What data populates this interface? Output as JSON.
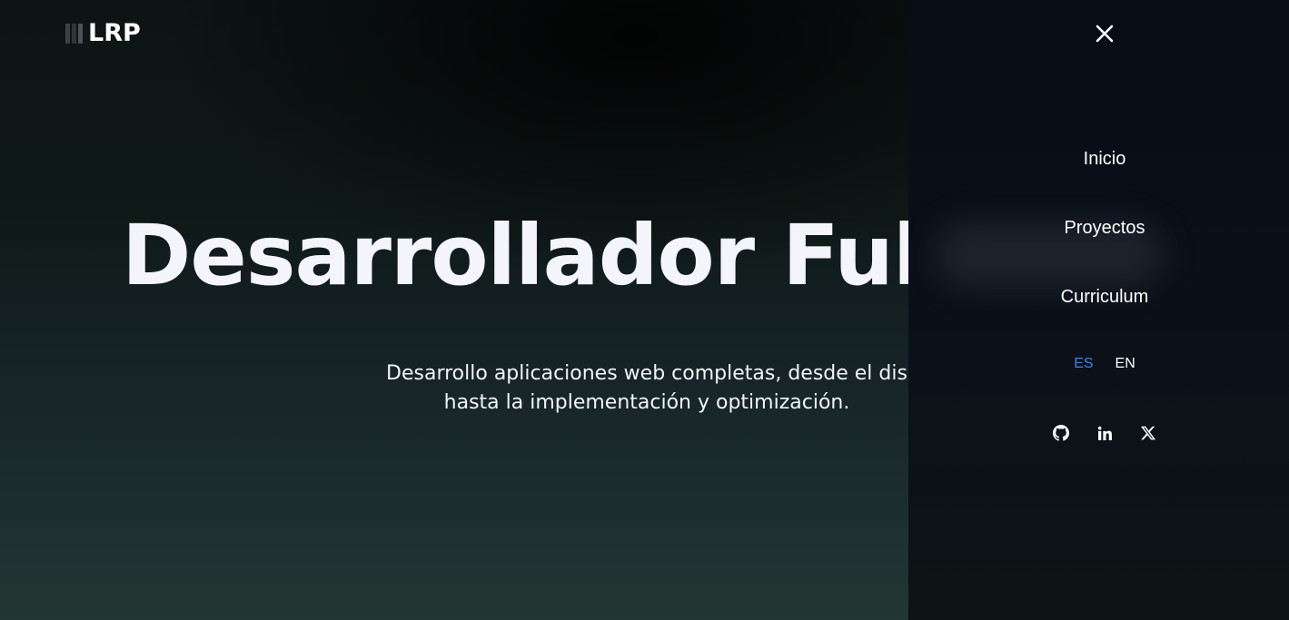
{
  "header": {
    "logo_text": "LRP"
  },
  "hero": {
    "title": "Desarrollador Full",
    "subtitle_line1": "Desarrollo aplicaciones web completas, desde el dis",
    "subtitle_line2": "hasta la implementación y optimización."
  },
  "drawer": {
    "close_icon": "close-icon",
    "nav_items": [
      {
        "label": "Inicio"
      },
      {
        "label": "Proyectos"
      },
      {
        "label": "Curriculum"
      }
    ],
    "languages": [
      {
        "label": "ES",
        "active": true,
        "color": "#3b82f6"
      },
      {
        "label": "EN",
        "active": false,
        "color": "#ffffff"
      }
    ],
    "socials": [
      {
        "icon": "github-icon"
      },
      {
        "icon": "linkedin-icon"
      },
      {
        "icon": "x-twitter-icon"
      }
    ]
  },
  "colors": {
    "accent": "#3b82f6",
    "drawer_bg": "#070c17",
    "text": "#ffffff"
  }
}
